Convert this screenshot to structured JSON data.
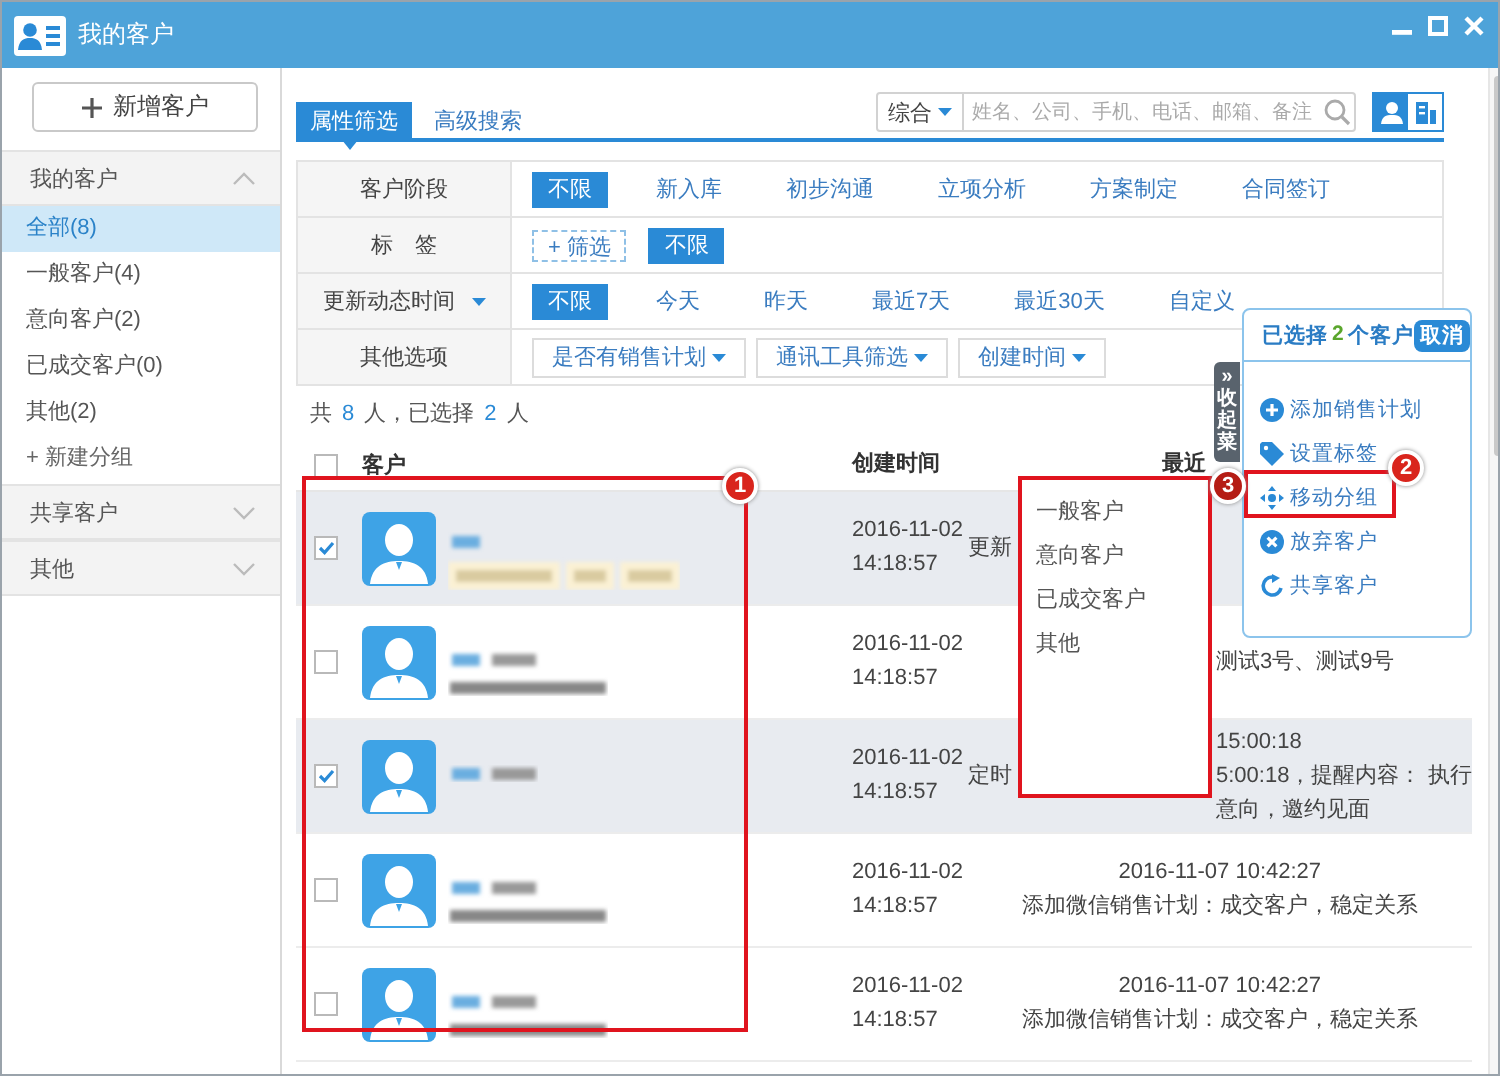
{
  "window": {
    "title": "我的客户"
  },
  "sidebar": {
    "add_button": "新增客户",
    "groups": [
      {
        "label": "我的客户",
        "expanded": true,
        "items": [
          {
            "label": "全部(8)",
            "selected": true
          },
          {
            "label": "一般客户(4)",
            "selected": false
          },
          {
            "label": "意向客户(2)",
            "selected": false
          },
          {
            "label": "已成交客户(0)",
            "selected": false
          },
          {
            "label": "其他(2)",
            "selected": false
          }
        ],
        "new_group": "+ 新建分组"
      },
      {
        "label": "共享客户",
        "expanded": false
      },
      {
        "label": "其他",
        "expanded": false
      }
    ]
  },
  "tabs": [
    {
      "label": "属性筛选",
      "selected": true
    },
    {
      "label": "高级搜索",
      "selected": false
    }
  ],
  "search": {
    "scope": "综合",
    "placeholder": "姓名、公司、手机、电话、邮箱、备注"
  },
  "views": [
    {
      "kind": "person",
      "selected": true
    },
    {
      "kind": "company",
      "selected": false
    }
  ],
  "filters": [
    {
      "label": "客户阶段",
      "kind": "options",
      "options": [
        {
          "label": "不限",
          "selected": true
        },
        {
          "label": "新入库",
          "selected": false
        },
        {
          "label": "初步沟通",
          "selected": false
        },
        {
          "label": "立项分析",
          "selected": false
        },
        {
          "label": "方案制定",
          "selected": false
        },
        {
          "label": "合同签订",
          "selected": false
        }
      ]
    },
    {
      "label": "标　签",
      "kind": "tags",
      "add": "+ 筛选",
      "options": [
        {
          "label": "不限",
          "selected": true
        }
      ]
    },
    {
      "label": "更新动态时间",
      "kind": "options",
      "caret": true,
      "options": [
        {
          "label": "不限",
          "selected": true
        },
        {
          "label": "今天",
          "selected": false
        },
        {
          "label": "昨天",
          "selected": false
        },
        {
          "label": "最近7天",
          "selected": false
        },
        {
          "label": "最近30天",
          "selected": false
        },
        {
          "label": "自定义",
          "selected": false
        }
      ]
    },
    {
      "label": "其他选项",
      "kind": "dropdowns",
      "dropdowns": [
        "是否有销售计划",
        "通讯工具筛选",
        "创建时间"
      ]
    }
  ],
  "summary": [
    {
      "text": "共",
      "kind": "plain"
    },
    {
      "text": "8",
      "kind": "count"
    },
    {
      "text": "人，已选择",
      "kind": "plain"
    },
    {
      "text": "2",
      "kind": "count"
    },
    {
      "text": "人",
      "kind": "plain"
    }
  ],
  "table": {
    "checked": false,
    "columns": [
      "客户",
      "创建时间",
      "最近"
    ],
    "rows": [
      {
        "selected": true,
        "checked": true,
        "kind": "tags",
        "created_date": "2016-11-02",
        "created_time": "14:18:57",
        "latest": [
          {
            "left": "更新"
          }
        ]
      },
      {
        "selected": false,
        "checked": false,
        "kind": "company",
        "created_date": "2016-11-02",
        "created_time": "14:18:57",
        "latest": [
          {
            "right": "测试3号、测试9号"
          }
        ]
      },
      {
        "selected": true,
        "checked": true,
        "kind": "name",
        "created_date": "2016-11-02",
        "created_time": "14:18:57",
        "latest": [
          {
            "right": "15:00:18"
          },
          {
            "left": "定时",
            "right": "5:00:18，提醒内容： 执行"
          },
          {
            "right": "意向，邀约见面"
          }
        ]
      },
      {
        "selected": false,
        "checked": false,
        "kind": "company",
        "created_date": "2016-11-02",
        "created_time": "14:18:57",
        "latest": [
          {
            "center": "2016-11-07 10:42:27"
          },
          {
            "center": "添加微信销售计划：成交客户，稳定关系"
          }
        ]
      },
      {
        "selected": false,
        "checked": false,
        "kind": "company",
        "created_date": "2016-11-02",
        "created_time": "14:18:57",
        "latest": [
          {
            "center": "2016-11-07 10:42:27"
          },
          {
            "center": "添加微信销售计划：成交客户，稳定关系"
          }
        ]
      }
    ]
  },
  "panel": {
    "title": [
      {
        "text": "已选择",
        "kind": "plain"
      },
      {
        "text": "2",
        "kind": "count"
      },
      {
        "text": "个客户",
        "kind": "plain"
      }
    ],
    "cancel": "取消",
    "actions": [
      {
        "label": "添加销售计划",
        "kind": "plus"
      },
      {
        "label": "设置标签",
        "kind": "tag"
      },
      {
        "label": "移动分组",
        "kind": "move"
      },
      {
        "label": "放弃客户",
        "kind": "cross"
      },
      {
        "label": "共享客户",
        "kind": "share"
      }
    ]
  },
  "collapse_tab": "»收起菜",
  "move_menu": [
    "一般客户",
    "意向客户",
    "已成交客户",
    "其他"
  ],
  "annotations": [
    "1",
    "2",
    "3"
  ]
}
